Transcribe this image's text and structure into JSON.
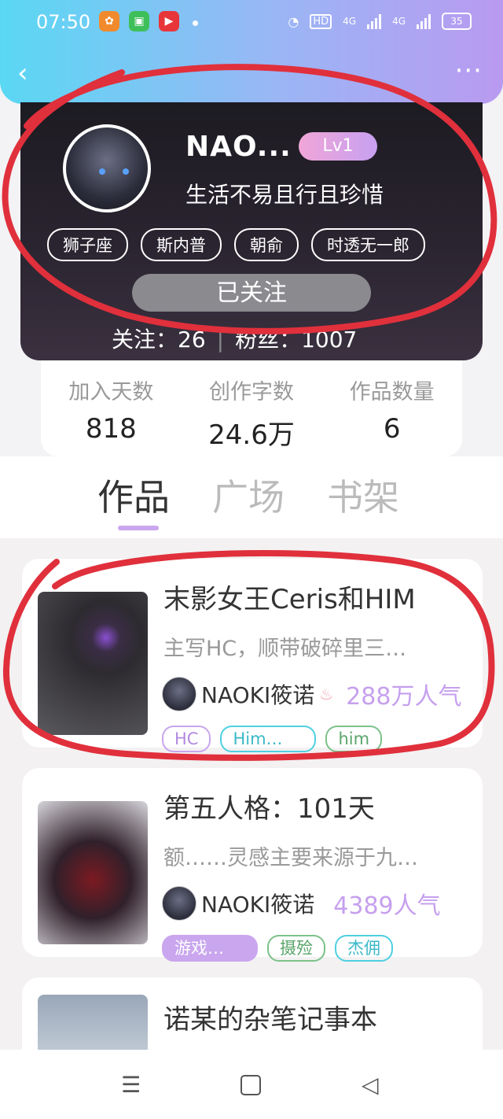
{
  "status_bar": {
    "time": "07:50",
    "hd_label": "HD",
    "net1": "4G",
    "net2": "4G",
    "battery": "35"
  },
  "profile": {
    "name": "NAO...",
    "level": "Lv1",
    "motto": "生活不易且行且珍惜",
    "tags": [
      "狮子座",
      "斯内普",
      "朝俞",
      "时透无一郎"
    ],
    "follow_button": "已关注",
    "follow_line": "关注：26",
    "fans_line": "粉丝：1007"
  },
  "stats": [
    {
      "label": "加入天数",
      "value": "818"
    },
    {
      "label": "创作字数",
      "value": "24.6万"
    },
    {
      "label": "作品数量",
      "value": "6"
    }
  ],
  "tabs": [
    "作品",
    "广场",
    "书架"
  ],
  "active_tab": "作品",
  "works": [
    {
      "title": "末影女王Ceris和HIM",
      "desc": "主写HC，顺带破碎里三…",
      "author": "NAOKI筱诺",
      "popularity": "288万人气",
      "tags": [
        "HC",
        "Him…",
        "him"
      ]
    },
    {
      "title": "第五人格：101天",
      "desc": "额……灵感主要来源于九…",
      "author": "NAOKI筱诺",
      "popularity": "4389人气",
      "tags": [
        "游戏…",
        "摄殓",
        "杰佣"
      ]
    },
    {
      "title": "诺某的杂笔记事本"
    }
  ],
  "colors": {
    "accent_purple": "#c9a6ee",
    "annotation_red": "#e0303c"
  }
}
